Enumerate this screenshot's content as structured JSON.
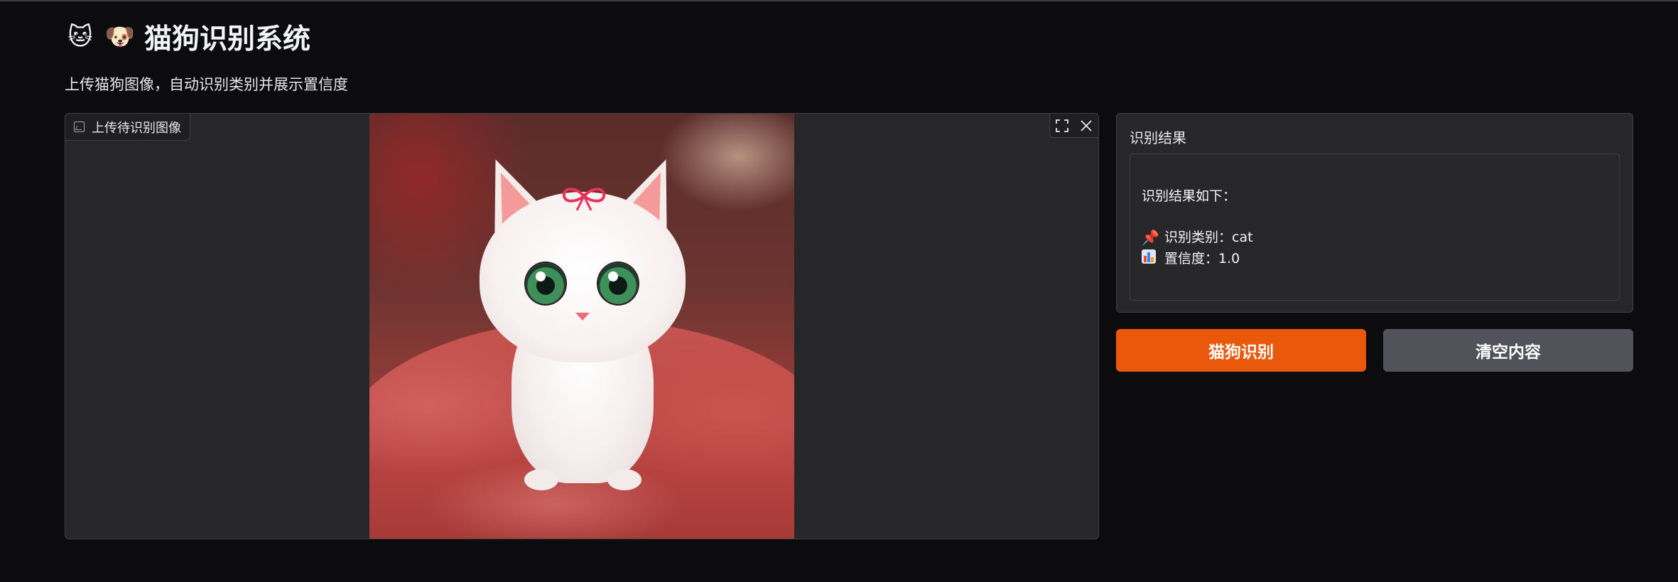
{
  "app": {
    "title_icons": [
      "🐱",
      "🐶"
    ],
    "title": "猫狗识别系统",
    "subtitle": "上传猫狗图像，自动识别类别并展示置信度"
  },
  "image_panel": {
    "label": "上传待识别图像",
    "fullscreen_icon": "fullscreen-icon",
    "close_icon": "close-icon"
  },
  "result_panel": {
    "title": "识别结果",
    "heading": "识别结果如下：",
    "category_icon": "📌",
    "category_line": "识别类别：cat",
    "confidence_icon": "bar-chart-icon",
    "confidence_line": "置信度：1.0"
  },
  "buttons": {
    "recognize": "猫狗识别",
    "clear": "清空内容"
  },
  "colors": {
    "background": "#0c0c0f",
    "panel": "#27272a",
    "primary_button": "#ea580c",
    "secondary_button": "#52525b"
  }
}
